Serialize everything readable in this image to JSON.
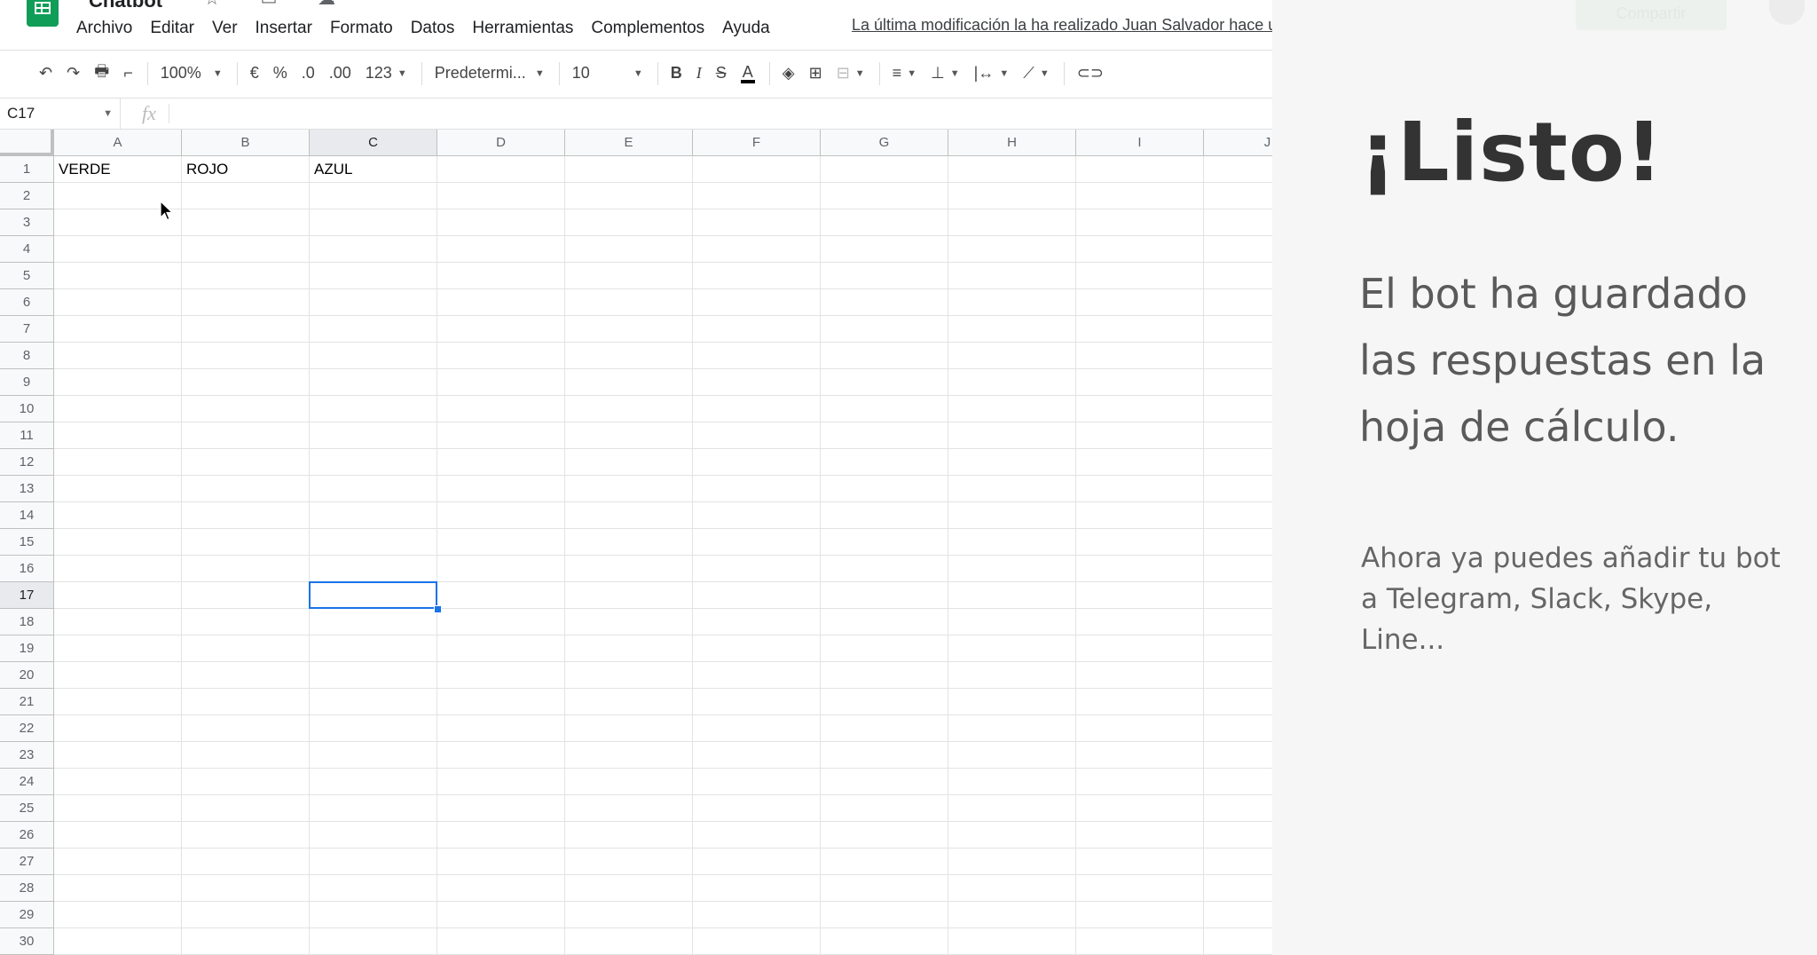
{
  "app": {
    "title": "Chatbot",
    "title_icons": "☆ ▭ ☁",
    "last_edit": "La última modificación la ha realizado Juan Salvador hace unos segundos"
  },
  "menu": [
    "Archivo",
    "Editar",
    "Ver",
    "Insertar",
    "Formato",
    "Datos",
    "Herramientas",
    "Complementos",
    "Ayuda"
  ],
  "toolbar": {
    "undo": "↶",
    "redo": "↷",
    "print": "🖶",
    "paint_format": "⌐",
    "zoom": "100%",
    "currency": "€",
    "percent": "%",
    "decimal_decrease": ".0",
    "decimal_increase": ".00",
    "more_formats": "123",
    "font": "Predetermi...",
    "font_size": "10",
    "bold": "B",
    "italic": "I",
    "strikethrough": "S",
    "text_color": "A",
    "fill_color": "◈",
    "borders": "⊞",
    "merge": "⊟",
    "align": "≡",
    "valign": "⊥",
    "wrap": "|↔",
    "rotate": "⟋",
    "link": "⊂⊃"
  },
  "formula_bar": {
    "name_box": "C17",
    "fx": "fx",
    "value": ""
  },
  "grid": {
    "columns": [
      "A",
      "B",
      "C",
      "D",
      "E",
      "F",
      "G",
      "H",
      "I",
      "J"
    ],
    "rows": [
      "1",
      "2",
      "3",
      "4",
      "5",
      "6",
      "7",
      "8",
      "9",
      "10",
      "11",
      "12",
      "13",
      "14",
      "15",
      "16",
      "17",
      "18",
      "19",
      "20",
      "21",
      "22",
      "23",
      "24",
      "25",
      "26",
      "27",
      "28",
      "29",
      "30"
    ],
    "cells": {
      "A1": "VERDE",
      "B1": "ROJO",
      "C1": "AZUL"
    },
    "selected_cell": "C17",
    "selected_column": "C",
    "selected_row": "17"
  },
  "overlay": {
    "title": "¡Listo!",
    "body": "El bot ha guardado las respuestas en la hoja de cálculo.",
    "subtitle": "Ahora ya puedes añadir tu bot a Telegram, Slack, Skype, Line...",
    "share_ghost": "Compartir",
    "background": "#f6f6f6"
  },
  "colors": {
    "accent": "#1a73e8",
    "sheets_green": "#0f9d58"
  }
}
